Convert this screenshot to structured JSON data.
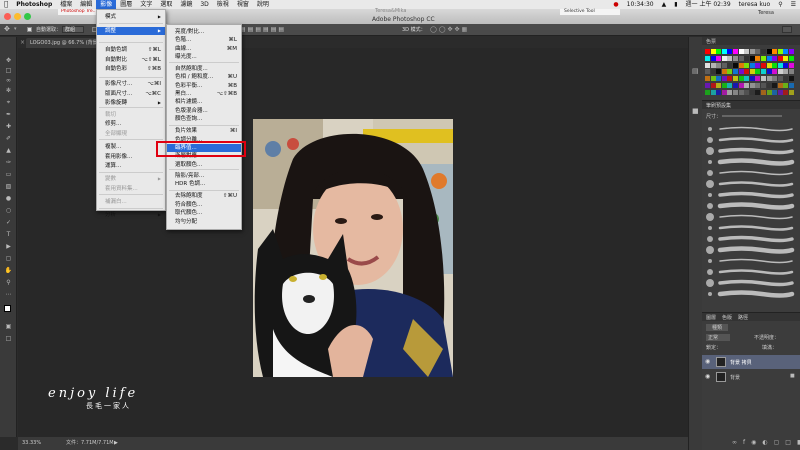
{
  "menubar": {
    "apple": "",
    "items": [
      "Photoshop",
      "檔案",
      "編輯",
      "影像",
      "圖層",
      "文字",
      "選取",
      "濾鏡",
      "3D",
      "檢視",
      "視窗",
      "說明"
    ],
    "active_index": 3,
    "clock": "週一 上午 02:39",
    "user": "teresa kuo",
    "time_small": "10:34:30"
  },
  "titlebar": {
    "title": "Adobe Photoshop CC",
    "tab_top": "Teresa&Mika",
    "browser_tab": "Selective Tool",
    "right_label": "Teresa",
    "left_tab": "Photoshop Tre..."
  },
  "options": {
    "auto_select": "自動選取：",
    "layer": "群組",
    "mode": "3D 模式："
  },
  "document": {
    "tab": "LOGO03.jpg @ 66.7% (背景 ...",
    "zoom": "33.33%",
    "doc_size": "文件：7.71M/7.71M"
  },
  "image_menu": {
    "items": [
      {
        "label": "模式",
        "shortcut": "",
        "arrow": true
      },
      {
        "label": "調整",
        "shortcut": "",
        "arrow": true,
        "highlight": true
      },
      {
        "label": "自動色調",
        "shortcut": "⇧⌘L"
      },
      {
        "label": "自動對比",
        "shortcut": "⌥⇧⌘L"
      },
      {
        "label": "自動色彩",
        "shortcut": "⇧⌘B"
      },
      {
        "label": "影像尺寸...",
        "shortcut": "⌥⌘I"
      },
      {
        "label": "版面尺寸...",
        "shortcut": "⌥⌘C"
      },
      {
        "label": "影像旋轉",
        "shortcut": "",
        "arrow": true
      },
      {
        "label": "裁切",
        "shortcut": "",
        "disabled": true
      },
      {
        "label": "修剪...",
        "shortcut": ""
      },
      {
        "label": "全部顯現",
        "shortcut": "",
        "disabled": true
      },
      {
        "label": "複製...",
        "shortcut": ""
      },
      {
        "label": "套用影像...",
        "shortcut": ""
      },
      {
        "label": "運算...",
        "shortcut": ""
      },
      {
        "label": "變數",
        "shortcut": "",
        "arrow": true,
        "disabled": true
      },
      {
        "label": "套用資料集...",
        "shortcut": "",
        "disabled": true
      },
      {
        "label": "補漏白...",
        "shortcut": "",
        "disabled": true
      },
      {
        "label": "分析",
        "shortcut": "",
        "arrow": true
      }
    ]
  },
  "adjust_menu": {
    "items": [
      {
        "label": "亮度/對比...",
        "shortcut": ""
      },
      {
        "label": "色階...",
        "shortcut": "⌘L"
      },
      {
        "label": "曲線...",
        "shortcut": "⌘M"
      },
      {
        "label": "曝光度...",
        "shortcut": ""
      },
      {
        "label": "自然飽和度...",
        "shortcut": ""
      },
      {
        "label": "色相 / 飽和度...",
        "shortcut": "⌘U"
      },
      {
        "label": "色彩平衡...",
        "shortcut": "⌘B"
      },
      {
        "label": "黑白...",
        "shortcut": "⌥⇧⌘B"
      },
      {
        "label": "相片濾鏡...",
        "shortcut": ""
      },
      {
        "label": "色版混合器...",
        "shortcut": ""
      },
      {
        "label": "顏色查詢...",
        "shortcut": ""
      },
      {
        "label": "負片效果",
        "shortcut": "⌘I"
      },
      {
        "label": "色調分離...",
        "shortcut": ""
      },
      {
        "label": "臨界值...",
        "shortcut": "",
        "highlight": true
      },
      {
        "label": "漸層對應...",
        "shortcut": ""
      },
      {
        "label": "選取顏色...",
        "shortcut": ""
      },
      {
        "label": "陰影/亮部...",
        "shortcut": ""
      },
      {
        "label": "HDR 色調...",
        "shortcut": ""
      },
      {
        "label": "去除飽和度",
        "shortcut": "⇧⌘U"
      },
      {
        "label": "符合顏色...",
        "shortcut": ""
      },
      {
        "label": "取代顏色...",
        "shortcut": ""
      },
      {
        "label": "均勻分配",
        "shortcut": ""
      }
    ]
  },
  "panels": {
    "swatches_tab": "色票",
    "brush_tab": "筆刷預設集",
    "brush_size": "尺寸：",
    "layers_tabs": [
      "圖層",
      "色版",
      "路徑"
    ],
    "kind": "種類",
    "blend": "正常",
    "opacity": "不透明度：",
    "lock": "鎖定：",
    "fill": "填滿：",
    "layers": [
      {
        "name": "背景 拷貝",
        "selected": true
      },
      {
        "name": "背景",
        "selected": false
      }
    ]
  },
  "watermark": {
    "line1": "enjoy life",
    "line2": "長毛一家人"
  },
  "colors": {
    "accent": "#2a6bd8",
    "highlight_box": "#e00010"
  }
}
